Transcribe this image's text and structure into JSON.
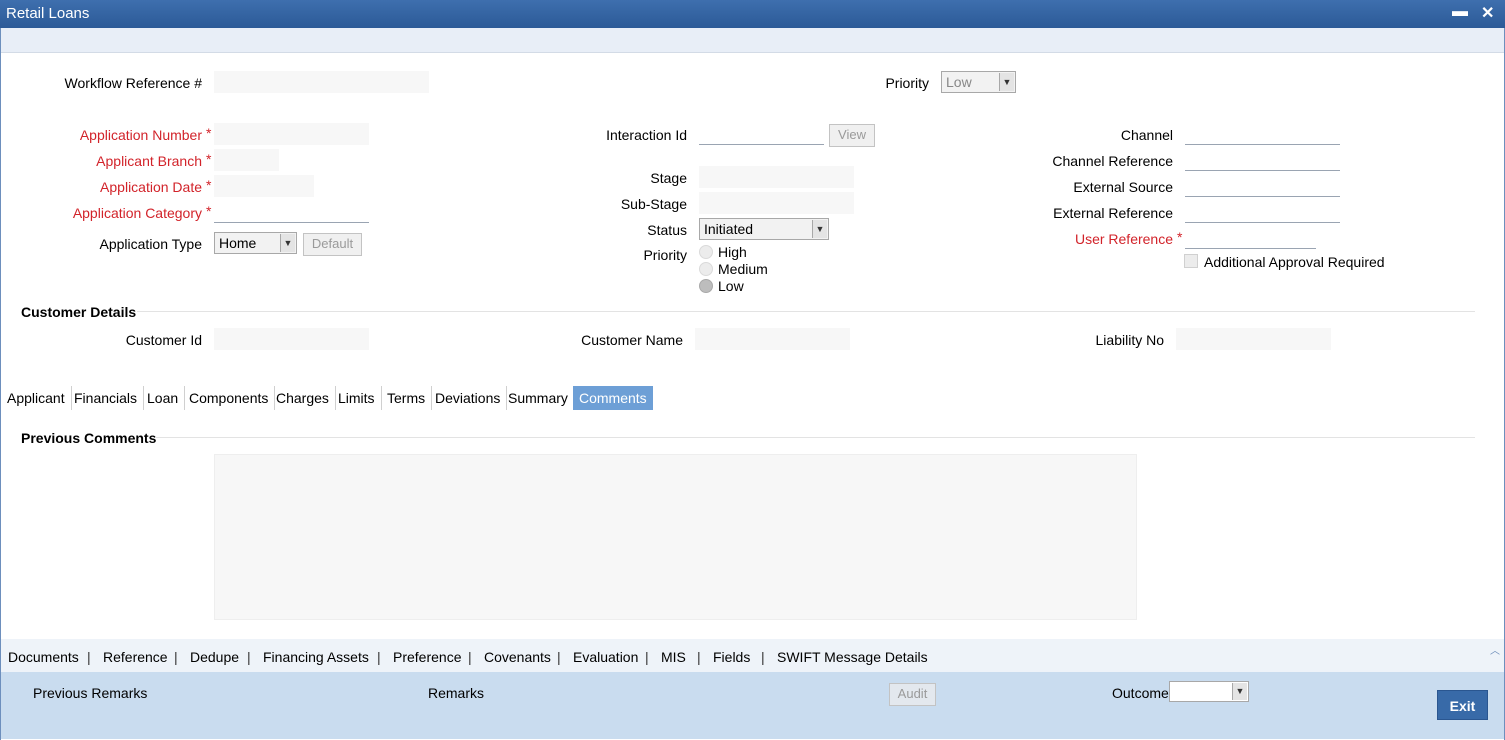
{
  "window": {
    "title": "Retail Loans",
    "minimize_glyph": "▬",
    "close_glyph": "✕"
  },
  "header": {
    "workflow_reference_label": "Workflow Reference #",
    "workflow_reference_value": "",
    "priority_label": "Priority",
    "priority_value": "Low"
  },
  "application": {
    "number_label": "Application Number",
    "branch_label": "Applicant Branch",
    "date_label": "Application Date",
    "category_label": "Application Category",
    "type_label": "Application Type",
    "type_value": "Home",
    "default_button": "Default",
    "required_mark": "*"
  },
  "middle": {
    "interaction_id_label": "Interaction Id",
    "view_button": "View",
    "stage_label": "Stage",
    "sub_stage_label": "Sub-Stage",
    "status_label": "Status",
    "status_value": "Initiated",
    "priority_label": "Priority",
    "priority_options": [
      "High",
      "Medium",
      "Low"
    ],
    "priority_selected": "Low"
  },
  "right": {
    "channel_label": "Channel",
    "channel_reference_label": "Channel Reference",
    "external_source_label": "External Source",
    "external_reference_label": "External Reference",
    "user_reference_label": "User Reference",
    "additional_approval_label": "Additional Approval Required"
  },
  "customer": {
    "section_title": "Customer Details",
    "customer_id_label": "Customer Id",
    "customer_name_label": "Customer Name",
    "liability_no_label": "Liability No"
  },
  "tabs": [
    "Applicant",
    "Financials",
    "Loan",
    "Components",
    "Charges",
    "Limits",
    "Terms",
    "Deviations",
    "Summary",
    "Comments"
  ],
  "active_tab": "Comments",
  "comments": {
    "section_title": "Previous Comments"
  },
  "bottom_nav": [
    "Documents",
    "Reference",
    "Dedupe",
    "Financing Assets",
    "Preference",
    "Covenants",
    "Evaluation",
    "MIS",
    "Fields",
    "SWIFT Message Details"
  ],
  "bottom_nav_separator": "|",
  "footer": {
    "previous_remarks_label": "Previous Remarks",
    "remarks_label": "Remarks",
    "audit_button": "Audit",
    "outcome_label": "Outcome",
    "outcome_value": "",
    "exit_button": "Exit"
  },
  "colors": {
    "titlebar": "#2c5a97",
    "required": "#d2232a",
    "active_tab": "#6d9fd6",
    "footer": "#c9dcef",
    "exit_button": "#386aa8"
  },
  "icons": [
    "minimize-icon",
    "close-icon",
    "dropdown-arrow-icon"
  ]
}
